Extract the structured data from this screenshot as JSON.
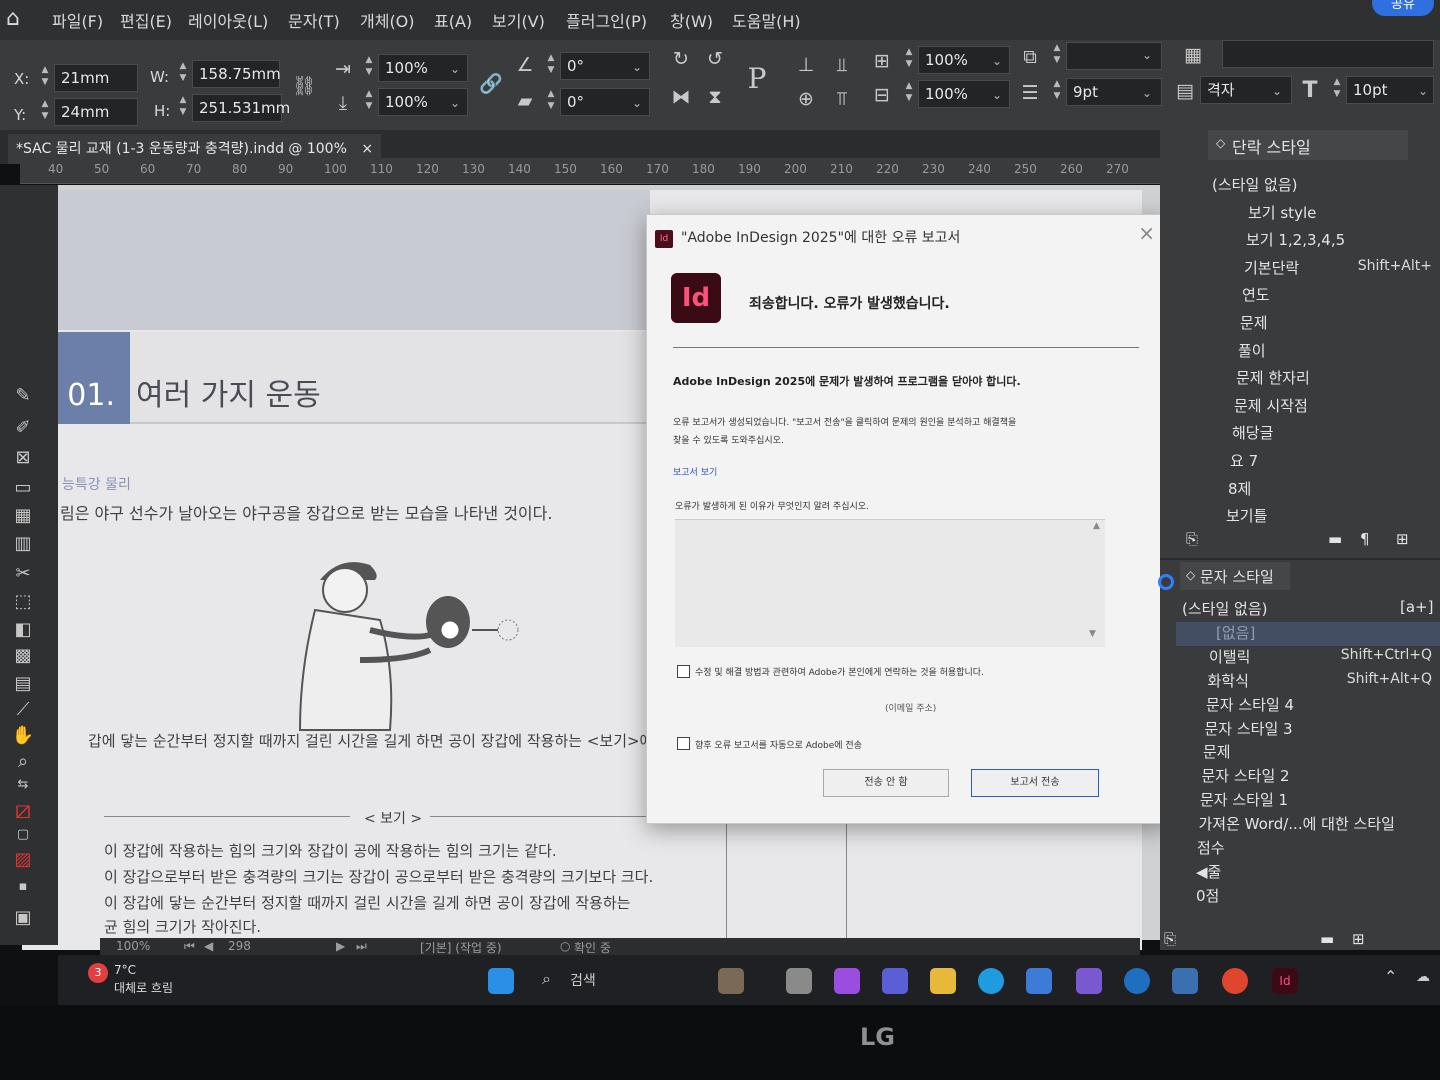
{
  "menu": {
    "home": "⌂",
    "items": [
      "파일(F)",
      "편집(E)",
      "레이아웃(L)",
      "문자(T)",
      "개체(O)",
      "표(A)",
      "보기(V)",
      "플러그인(P)",
      "창(W)",
      "도움말(H)"
    ],
    "share": "공유"
  },
  "control": {
    "x_label": "X:",
    "x_value": "21mm",
    "y_label": "Y:",
    "y_value": "24mm",
    "w_label": "W:",
    "w_value": "158.75mm",
    "h_label": "H:",
    "h_value": "251.531mm",
    "scale_x": "100%",
    "scale_y": "100%",
    "rotate": "0°",
    "shear": "0°",
    "p_icon": "P",
    "pct1": "100%",
    "pct2": "100%",
    "stroke": "9pt",
    "grid": "격자",
    "font_size": "10pt",
    "tt": "T"
  },
  "doc_tab": {
    "title": "*SAC 물리 교재 (1-3  운동량과 충격량).indd @ 100%",
    "close": "×"
  },
  "ruler": [
    "40",
    "50",
    "60",
    "70",
    "80",
    "90",
    "100",
    "110",
    "120",
    "130",
    "140",
    "150",
    "160",
    "170",
    "180",
    "190",
    "200",
    "210",
    "220",
    "230",
    "240",
    "250",
    "260",
    "270"
  ],
  "page": {
    "chapter_num": "t 01.",
    "chapter_title": "여러 가지 운동",
    "section": "능특강 물리",
    "line1": "림은 야구 선수가 날아오는 야구공을 장갑으로 받는 모습을 나타낸 것이다.",
    "line2": "갑에 닿는 순간부터 정지할 때까지 걸린 시간을 길게 하면 공이 장갑에 작용하는 <보기>에서 있는",
    "bogi": "< 보기 >",
    "opt1": "이 장갑에 작용하는 힘의 크기와 장갑이 공에 작용하는 힘의 크기는 같다.",
    "opt2": "이 장갑으로부터 받은 충격량의 크기는 장갑이 공으로부터 받은 충격량의 크기보다 크다.",
    "opt3": "이 장갑에 닿는 순간부터 정지할 때까지 걸린 시간을 길게 하면 공이 장갑에 작용하는",
    "opt4": "균 힘의 크기가 작아진다."
  },
  "dialog": {
    "small_icon": "Id",
    "title": "\"Adobe InDesign 2025\"에 대한 오류 보고서",
    "close": "×",
    "logo": "Id",
    "headline": "죄송합니다. 오류가 발생했습니다.",
    "bold_line": "Adobe InDesign 2025에 문제가 발생하여 프로그램을 닫아야 합니다.",
    "desc1": "오류 보고서가 생성되었습니다. \"보고서 전송\"을 클릭하여 문제의 원인을 분석하고 해결책을",
    "desc2": "찾을 수 있도록 도와주십시오.",
    "view_link": "보고서 보기",
    "reason_prompt": "오류가 발생하게 된 이유가 무엇인지 알려 주십시오.",
    "reason_value": "",
    "contact_label": "수정 및 해결 방법과 관련하여 Adobe가 본인에게 연락하는 것을 허용합니다.",
    "email_placeholder": "(이메일 주소)",
    "auto_label": "향후 오류 보고서를 자동으로 Adobe에 전송",
    "dont_send": "전송 안 함",
    "send": "보고서 전송"
  },
  "paragraph_styles": {
    "header": "단락 스타일",
    "items": [
      {
        "name": "(스타일 없음)",
        "shortcut": ""
      },
      {
        "name": "보기 style",
        "shortcut": ""
      },
      {
        "name": "보기 1,2,3,4,5",
        "shortcut": ""
      },
      {
        "name": "기본단락",
        "shortcut": "Shift+Alt+"
      },
      {
        "name": "연도",
        "shortcut": ""
      },
      {
        "name": "문제",
        "shortcut": ""
      },
      {
        "name": "풀이",
        "shortcut": ""
      },
      {
        "name": "문제 한자리",
        "shortcut": ""
      },
      {
        "name": "문제 시작점",
        "shortcut": ""
      },
      {
        "name": "해당글",
        "shortcut": ""
      },
      {
        "name": "요 7",
        "shortcut": ""
      },
      {
        "name": "8제",
        "shortcut": ""
      },
      {
        "name": "보기틀",
        "shortcut": ""
      }
    ]
  },
  "character_styles": {
    "header": "문자 스타일",
    "new_style_icon": "[a+]",
    "items": [
      {
        "name": "(스타일 없음)",
        "shortcut": ""
      },
      {
        "name": "[없음]",
        "shortcut": ""
      },
      {
        "name": "이탤릭",
        "shortcut": "Shift+Ctrl+Q"
      },
      {
        "name": "화학식",
        "shortcut": "Shift+Alt+Q"
      },
      {
        "name": "문자 스타일 4",
        "shortcut": ""
      },
      {
        "name": "문자 스타일 3",
        "shortcut": ""
      },
      {
        "name": "문제",
        "shortcut": ""
      },
      {
        "name": "문자 스타일 2",
        "shortcut": ""
      },
      {
        "name": "문자 스타일 1",
        "shortcut": ""
      },
      {
        "name": "가져온 Word/...에 대한 스타일",
        "shortcut": ""
      },
      {
        "name": "점수",
        "shortcut": ""
      },
      {
        "name": "◀줄",
        "shortcut": ""
      },
      {
        "name": "0점",
        "shortcut": ""
      }
    ]
  },
  "status_bar": {
    "zoom": "100%",
    "page": "298",
    "workspace": "[기본] (작업 중)",
    "preflight": "확인 중"
  },
  "taskbar": {
    "weather_badge": "3",
    "temp": "7°C",
    "weather": "대체로 흐림",
    "search": "검색"
  },
  "monitor": {
    "brand": "LG"
  },
  "colors": {
    "accent": "#2f6fe0",
    "indesign": "#ff3366",
    "selection": "#4d5f84",
    "chapter": "#6c7fa8"
  }
}
